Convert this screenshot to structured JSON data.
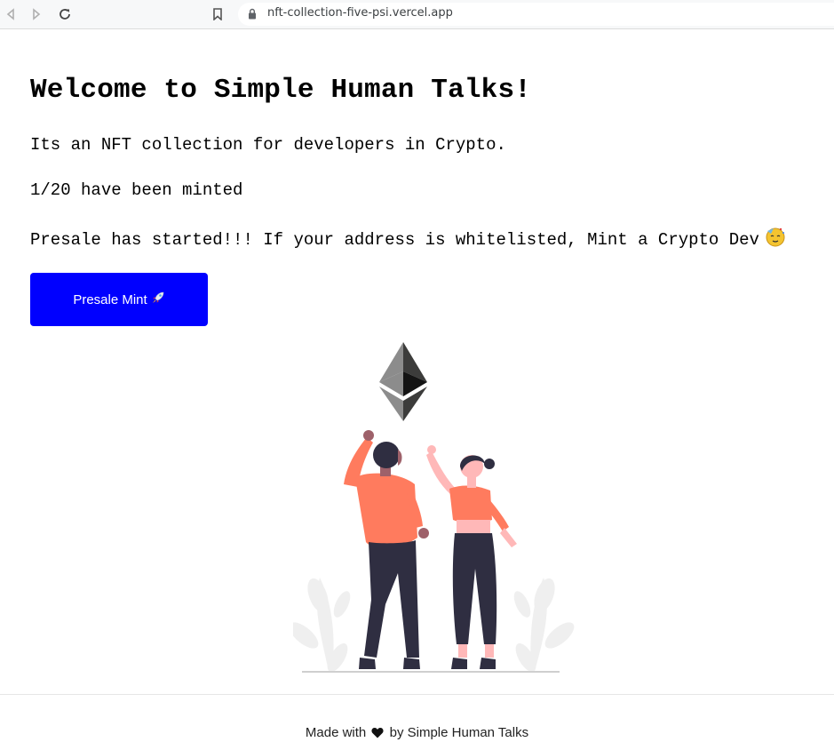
{
  "browser": {
    "url": "nft-collection-five-psi.vercel.app",
    "icons": [
      "back-icon",
      "forward-icon",
      "reload-icon",
      "bookmark-icon",
      "lock-icon"
    ]
  },
  "page": {
    "title": "Welcome to Simple Human Talks!",
    "description": "Its an NFT collection for developers in Crypto.",
    "minted": "1/20 have been minted",
    "presale_message": "Presale has started!!! If your address is whitelisted, Mint a Crypto Dev",
    "presale_emoji": "partying-face-icon",
    "mint_button": {
      "label": "Presale Mint",
      "icon": "rocket-icon"
    }
  },
  "colors": {
    "button_bg": "#0000ff",
    "button_text": "#ffffff",
    "shirt": "#ff7b5e",
    "pants": "#2f2e41"
  },
  "footer": {
    "prefix": "Made with",
    "icon": "heart-icon",
    "suffix": "by Simple Human Talks"
  }
}
